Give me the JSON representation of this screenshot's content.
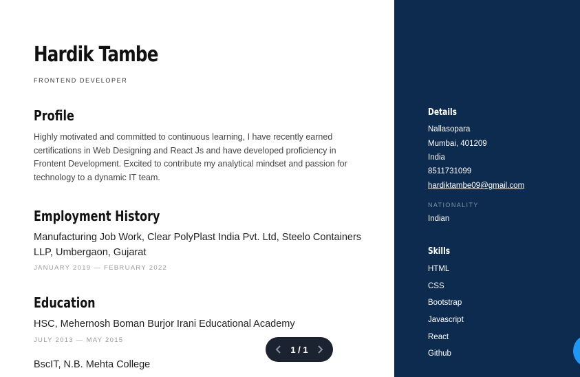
{
  "resume": {
    "name": "Hardik Tambe",
    "role": "FRONTEND DEVELOPER",
    "profile": {
      "heading": "Profile",
      "text": "Highly motivated and committed to continuous learning, I have recently earned certifications in Web Designing and React Js and have developed proficiency in Frontent Development. Excited to contribute my analytical mindset and passion for technology to a dynamic IT team."
    },
    "employment": {
      "heading": "Employment History",
      "jobs": [
        {
          "title": "Manufacturing Job Work, Clear PolyPlast India Pvt. Ltd, Steelo Containers LLP, Umbergaon, Gujarat",
          "dates": "JANUARY 2019 — FEBRUARY 2022"
        }
      ]
    },
    "education": {
      "heading": "Education",
      "items": [
        {
          "title": "HSC, Mehernosh Boman Burjor Irani Educational Academy",
          "dates": "JULY 2013 — MAY 2015"
        },
        {
          "title": "BscIT, N.B. Mehta College"
        }
      ]
    }
  },
  "sidebar": {
    "details_heading": "Details",
    "address_line1": "Nallasopara",
    "address_line2": "Mumbai, 401209",
    "country": "India",
    "phone": "8511731099",
    "email": "hardiktambe09@gmail.com",
    "nationality_label": "NATIONALITY",
    "nationality": "Indian",
    "skills_heading": "Skills",
    "skills": [
      "HTML",
      "CSS",
      "Bootstrap",
      "Javascript",
      "React",
      "Github"
    ]
  },
  "pager": {
    "count": "1 / 1",
    "prev_icon": "chevron-left-icon",
    "next_icon": "chevron-right-icon"
  },
  "colors": {
    "sidebar_bg": "#0d2b4e",
    "pager_bg": "#1b2330",
    "fab": "#2196f3"
  }
}
